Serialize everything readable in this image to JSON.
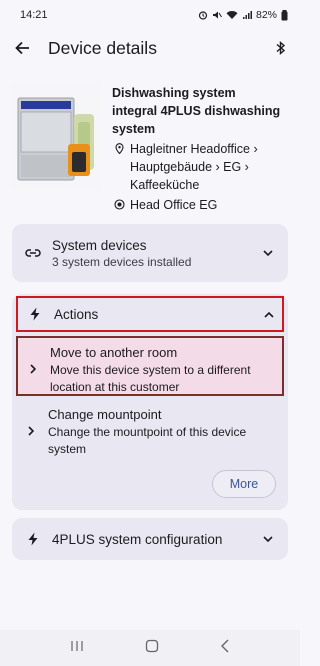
{
  "status": {
    "time": "14:21",
    "battery": "82%"
  },
  "appbar": {
    "title": "Device details"
  },
  "device": {
    "name": "Dishwashing system",
    "subtitle": "integral 4PLUS dishwashing system",
    "location": "Hagleitner Headoffice › Hauptgebäude › EG › Kaffeeküche",
    "site": "Head Office EG"
  },
  "system_devices": {
    "title": "System devices",
    "subtitle": "3 system devices installed"
  },
  "actions": {
    "title": "Actions",
    "items": [
      {
        "title": "Move to another room",
        "description": "Move this device system to a different location at this customer"
      },
      {
        "title": "Change mountpoint",
        "description": "Change the mountpoint of this device system"
      }
    ],
    "more_label": "More"
  },
  "config": {
    "title": "4PLUS system configuration"
  },
  "colors": {
    "highlight_border": "#d0181f",
    "accent": "#3b5598",
    "card_bg": "#e9e8f2"
  }
}
